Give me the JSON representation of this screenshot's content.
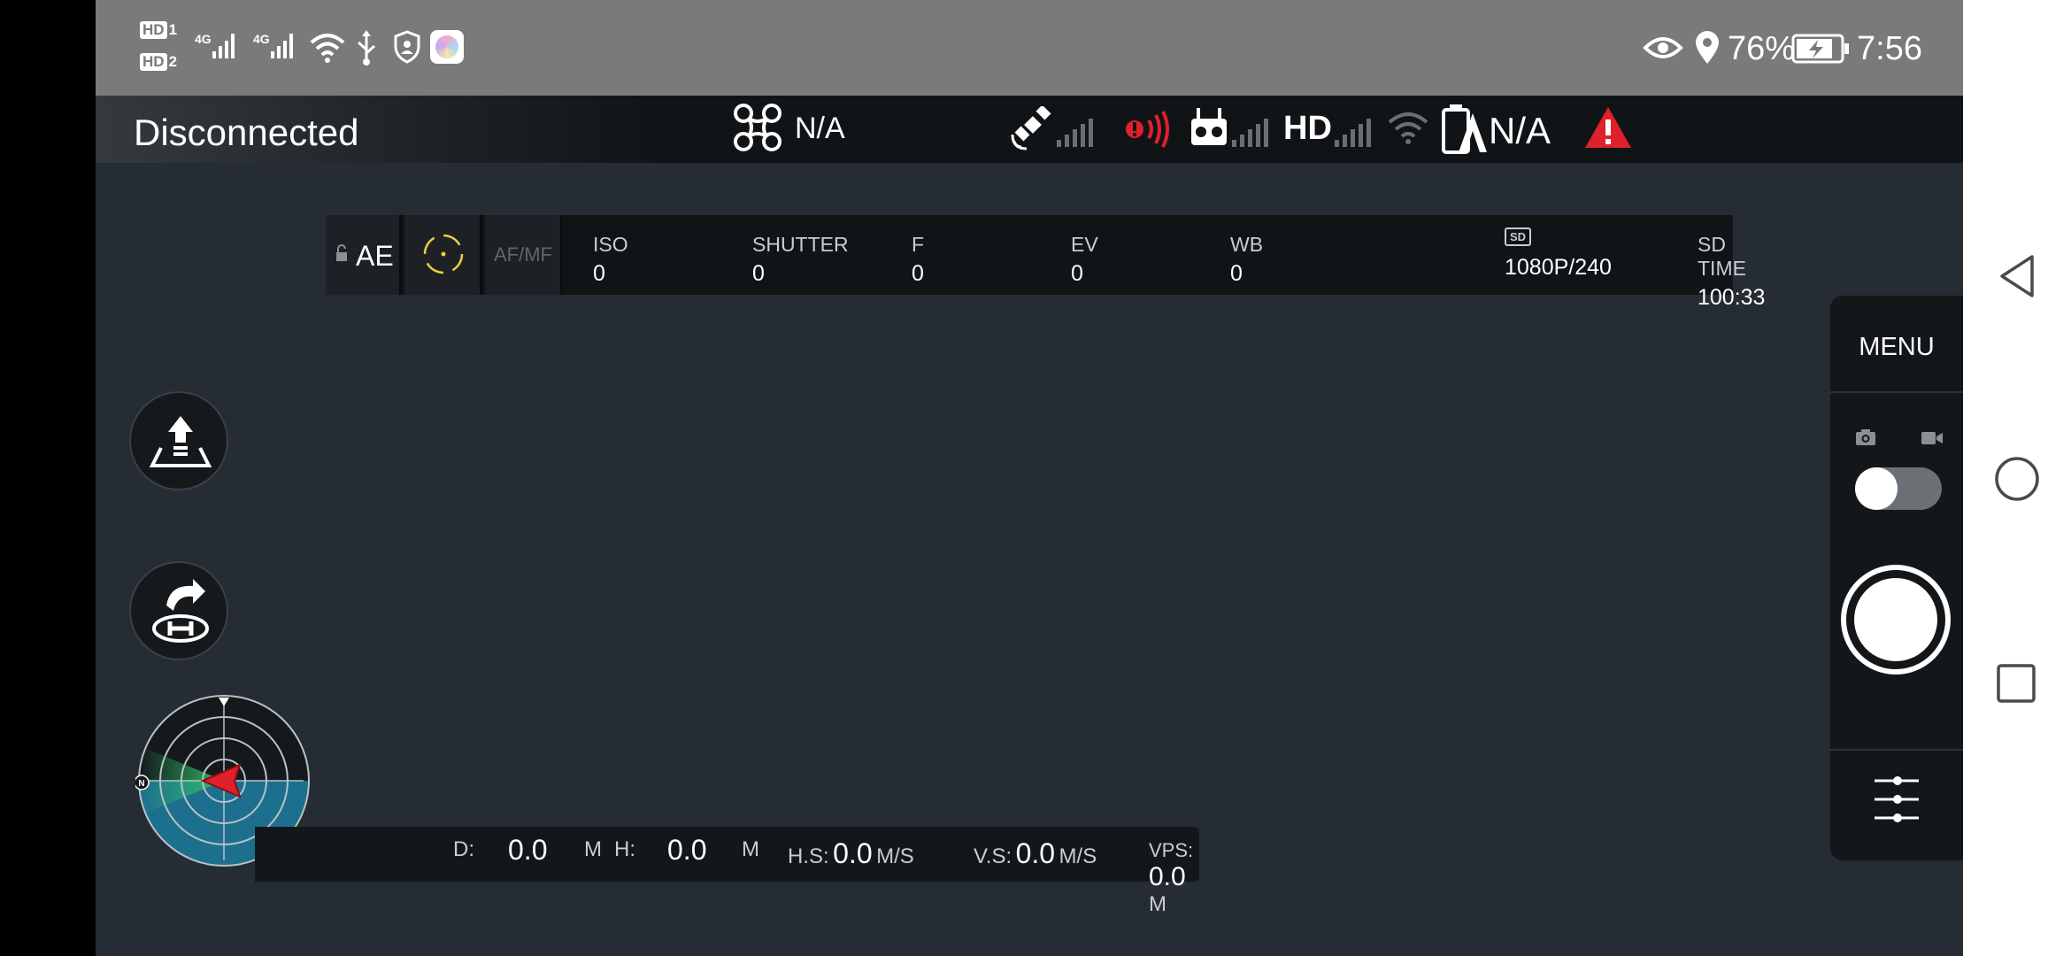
{
  "status_bar": {
    "hd1": "HD",
    "hd1_num": "1",
    "hd2": "HD",
    "hd2_num": "2",
    "net1": "4G",
    "net2": "4G",
    "battery_percent": "76%",
    "time": "7:56",
    "icons": [
      "eye-icon",
      "location-icon",
      "battery-charging-icon",
      "wifi-icon",
      "usb-icon",
      "shield-icon",
      "app-icon"
    ]
  },
  "header": {
    "connection_status": "Disconnected",
    "aircraft_mode": "N/A",
    "hd_label": "HD",
    "battery_value": "N/A",
    "icons": [
      "drone-icon",
      "satellite-icon",
      "signal-alert-icon",
      "remote-controller-icon",
      "hd-signal-icon",
      "wifi-icon",
      "battery-icon",
      "warning-icon"
    ]
  },
  "camera_bar": {
    "ae_label": "AE",
    "focus_mode": "AF/MF",
    "params": [
      {
        "label": "ISO",
        "value": "0"
      },
      {
        "label": "SHUTTER",
        "value": "0"
      },
      {
        "label": "F",
        "value": "0"
      },
      {
        "label": "EV",
        "value": "0"
      },
      {
        "label": "WB",
        "value": "0"
      }
    ],
    "sd_badge": "SD",
    "resolution": "1080P/240",
    "sd_time_label": "SD TIME",
    "sd_time_value": "100:33"
  },
  "telemetry": {
    "d_label": "D:",
    "d_value": "0.0",
    "d_unit": "M",
    "h_label": "H:",
    "h_value": "0.0",
    "h_unit": "M",
    "hs_label": "H.S:",
    "hs_value": "0.0",
    "hs_unit": "M/S",
    "vs_label": "V.S:",
    "vs_value": "0.0",
    "vs_unit": "M/S",
    "vps_label": "VPS:",
    "vps_value": "0.0",
    "vps_unit": "M"
  },
  "radar": {
    "north_label": "N"
  },
  "right_panel": {
    "menu_label": "MENU"
  },
  "colors": {
    "warning_red": "#e0202a",
    "focus_yellow": "#e8d23a",
    "radar_water": "#1d6f8e",
    "radar_green": "#2fbf68"
  }
}
